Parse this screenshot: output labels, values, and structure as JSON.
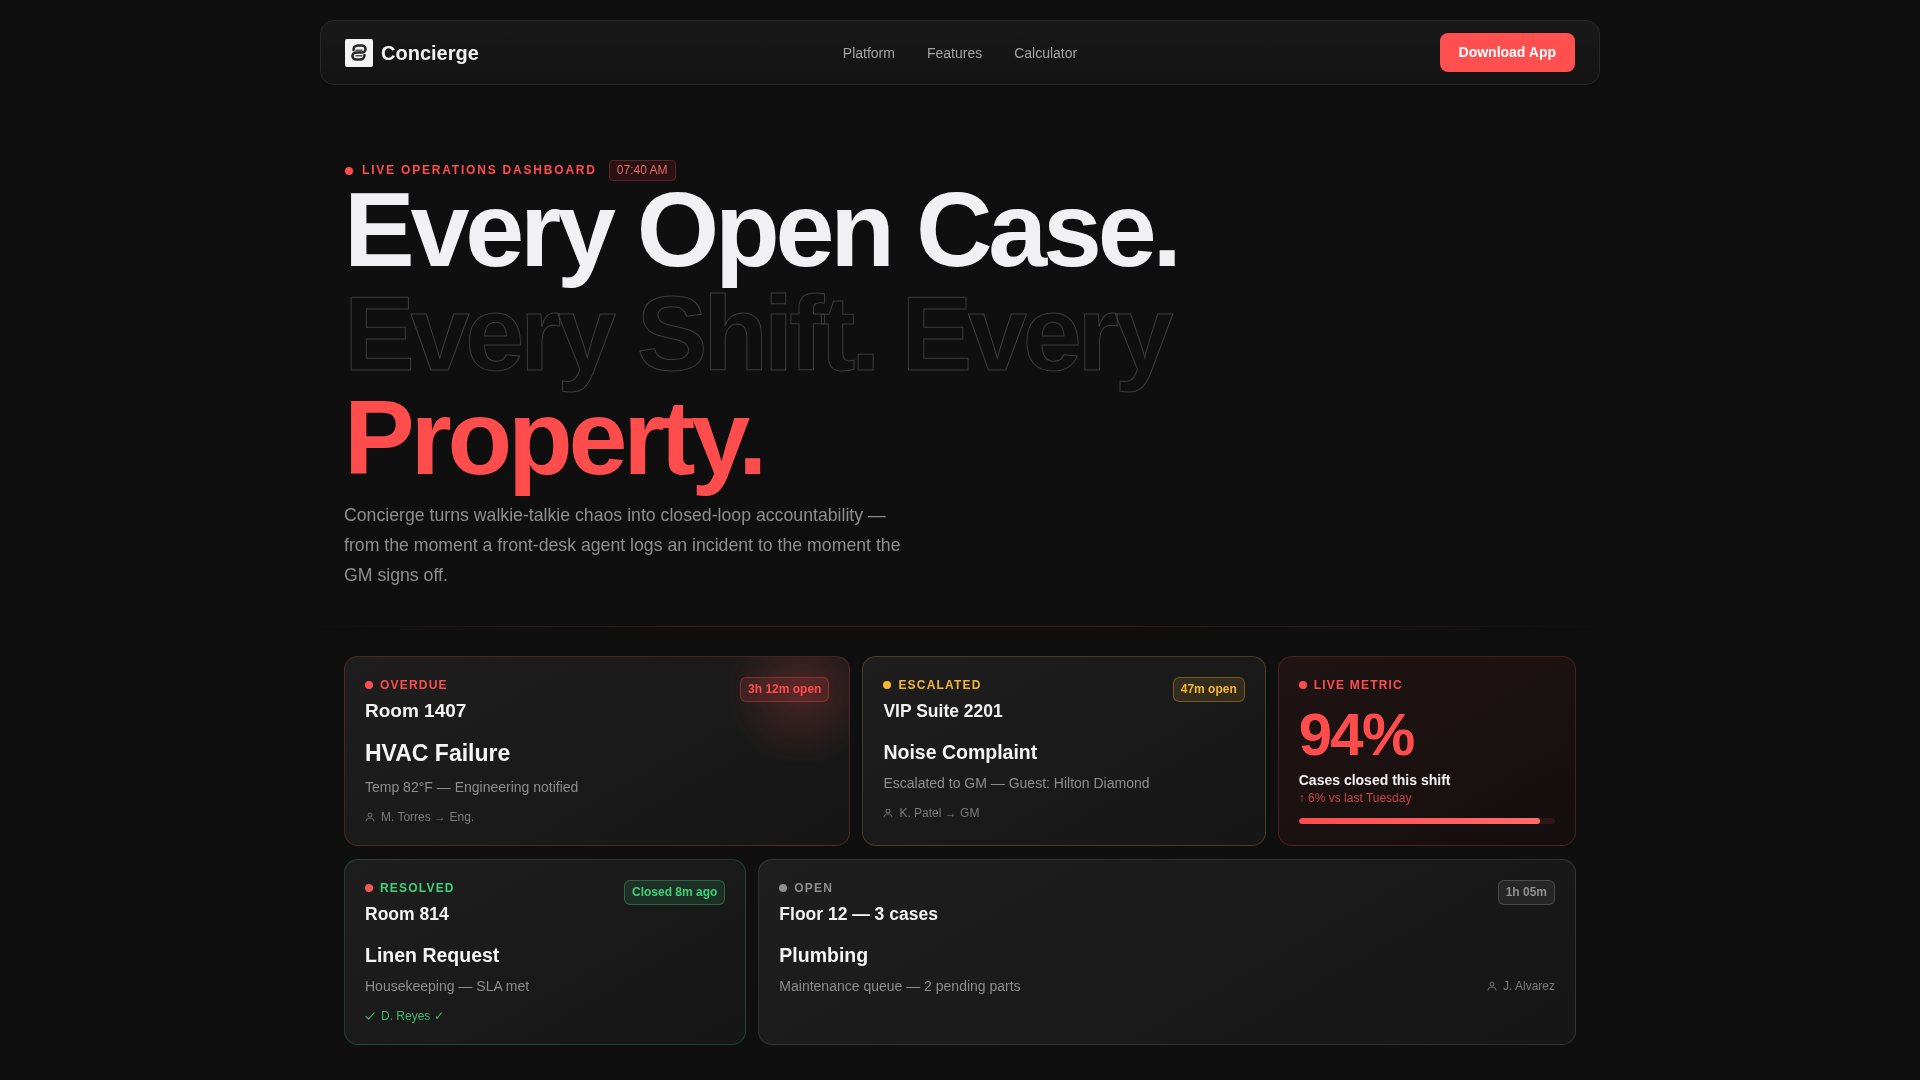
{
  "nav": {
    "brand": "Concierge",
    "links": [
      "Platform",
      "Features",
      "Calculator"
    ],
    "cta": "Download App"
  },
  "hero": {
    "eyebrow": {
      "label": "LIVE OPERATIONS DASHBOARD",
      "time": "07:40 AM"
    },
    "headline": [
      {
        "text": "Every Open Case.",
        "kind": "solid"
      },
      {
        "text": "Every Shift. Every",
        "kind": "outline"
      },
      {
        "text": "Property.",
        "kind": "accent"
      }
    ],
    "description": "Concierge turns walkie-talkie chaos into closed-loop accountability — from the moment a front-desk agent logs an incident to the moment the GM signs off."
  },
  "card_rows": [
    {
      "cards": [
        {
          "kind": "case",
          "highlighted": true,
          "status": {
            "dot": {
              "color": "#ff4d4d"
            },
            "label": {
              "text": "OVERDUE",
              "color": "#ff4d4d"
            }
          },
          "badge": "3h 12m open",
          "title": "Room 1407",
          "case": "HVAC Failure",
          "description": "Temp 82°F — Engineering notified",
          "assignee": {
            "kind": "assigned",
            "name": "M. Torres → Eng."
          }
        },
        {
          "kind": "case",
          "highlighted": false,
          "status": {
            "dot": {
              "color": "#f5b731"
            },
            "label": {
              "text": "ESCALATED",
              "color": "#f5b731"
            }
          },
          "badge": "47m open",
          "title": "VIP Suite 2201",
          "case": "Noise Complaint",
          "description": "Escalated to GM — Guest: Hilton Diamond",
          "assignee": {
            "kind": "assigned",
            "name": "K. Patel → GM"
          }
        },
        {
          "kind": "metric",
          "status": {
            "dot": {
              "color": "#ff4d4d"
            },
            "label": {
              "text": "LIVE METRIC",
              "color": "#ff4d4d"
            }
          },
          "value": "94%",
          "label": "Cases closed this shift",
          "trend": "↑ 6% vs last Tuesday",
          "level": 0.94
        }
      ]
    },
    {
      "cards": [
        {
          "kind": "case",
          "highlighted": false,
          "status": {
            "dot": {
              "color": "#f25a5a"
            },
            "label": {
              "text": "RESOLVED",
              "color": "#3fd17a"
            }
          },
          "badge": "Closed 8m ago",
          "title": "Room 814",
          "case": "Linen Request",
          "description": "Housekeeping — SLA met",
          "assignee": {
            "kind": "confirmed",
            "name": "D. Reyes ✓"
          }
        },
        {
          "kind": "summary",
          "highlighted": false,
          "status": {
            "dot": {
              "color": "#8f8f8f"
            },
            "label": {
              "text": "OPEN",
              "color": "#8f8f8f"
            }
          },
          "badge": "1h 05m",
          "title": "Floor 12 — 3 cases",
          "case": "Plumbing",
          "description": "Maintenance queue — 2 pending parts",
          "assignee": {
            "kind": "assigned",
            "name": "J. Alvarez"
          }
        }
      ]
    }
  ]
}
